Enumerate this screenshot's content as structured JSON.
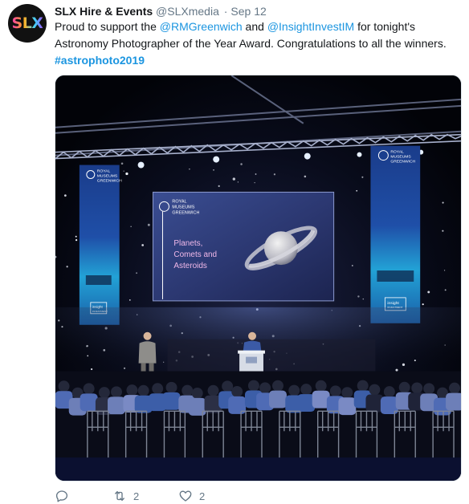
{
  "tweet": {
    "avatar_text": "SLX",
    "display_name": "SLX Hire & Events",
    "handle": "@SLXmedia",
    "separator": "·",
    "date": "Sep 12",
    "text": {
      "p1": "Proud to support the ",
      "mention1": "@RMGreenwich",
      "p2": " and ",
      "mention2": "@InsightInvestIM",
      "p3": " for tonight's Astronomy Photographer of the Year Award.  Congratulations to all the winners.",
      "hashtag": "#astrophoto2019"
    },
    "stats": {
      "replies": "",
      "retweets": "2",
      "likes": "2"
    }
  },
  "media": {
    "screen_logo": [
      "ROYAL",
      "MUSEUMS",
      "GREENWICH"
    ],
    "screen_title": [
      "Planets,",
      "Comets and",
      "Asteroids"
    ],
    "banner_logo": [
      "ROYAL",
      "MUSEUMS",
      "GREENWICH"
    ],
    "banner_bottom": [
      "insight",
      "INVESTMENT"
    ]
  },
  "icons": {
    "reply": "reply-icon",
    "retweet": "retweet-icon",
    "like": "heart-icon"
  },
  "colors": {
    "link": "#1b95e0",
    "muted": "#657786",
    "text": "#14171a"
  }
}
